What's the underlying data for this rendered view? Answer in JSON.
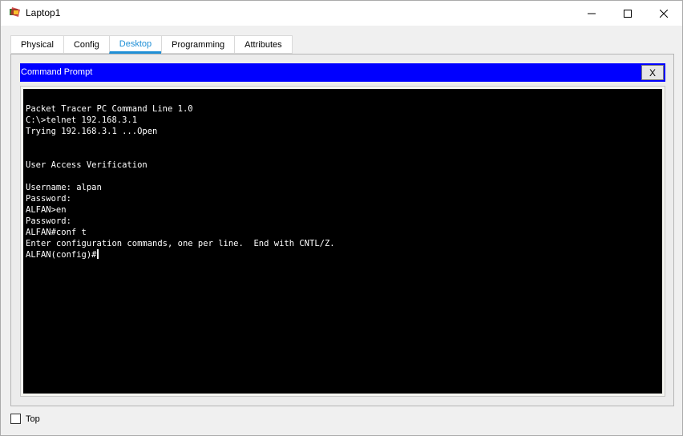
{
  "window": {
    "title": "Laptop1",
    "controls": {
      "minimize": "—",
      "maximize": "☐",
      "close": "✕"
    }
  },
  "tabs": [
    {
      "label": "Physical",
      "active": false
    },
    {
      "label": "Config",
      "active": false
    },
    {
      "label": "Desktop",
      "active": true
    },
    {
      "label": "Programming",
      "active": false
    },
    {
      "label": "Attributes",
      "active": false
    }
  ],
  "command_prompt": {
    "title": "Command Prompt",
    "close_label": "X",
    "lines": [
      "Packet Tracer PC Command Line 1.0",
      "C:\\>telnet 192.168.3.1",
      "Trying 192.168.3.1 ...Open",
      "",
      "",
      "User Access Verification",
      "",
      "Username: alpan",
      "Password: ",
      "ALFAN>en",
      "Password: ",
      "ALFAN#conf t",
      "Enter configuration commands, one per line.  End with CNTL/Z.",
      "ALFAN(config)#"
    ]
  },
  "bottom": {
    "top_checkbox_label": "Top",
    "top_checked": false
  },
  "colors": {
    "header_blue": "#0000ff",
    "active_tab": "#1f8fd6",
    "terminal_bg": "#000000",
    "terminal_fg": "#ffffff"
  }
}
